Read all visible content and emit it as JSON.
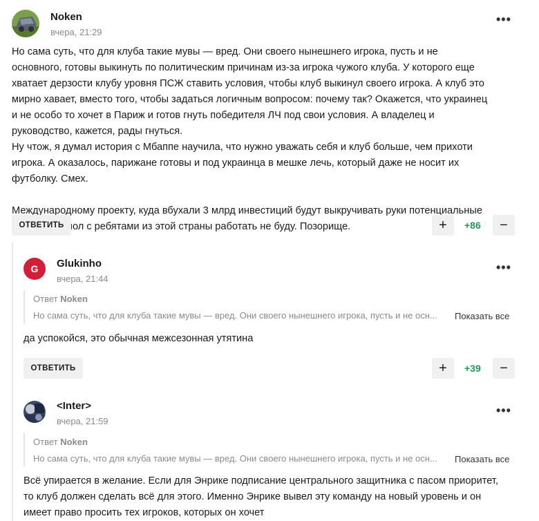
{
  "comments": [
    {
      "author": "Noken",
      "time": "вчера, 21:29",
      "paragraphs": [
        "Но сама суть, что для клуба такие мувы — вред. Они своего нынешнего игрока, пусть и не основного, готовы выкинуть по политическим причинам из-за игрока чужого клуба. У которого еще хватает дерзости клубу уровня ПСЖ ставить условия, чтобы клуб выкинул своего игрока. А клуб это мирно хавает, вместо того, чтобы задаться логичным вопросом: почему так? Окажется, что украинец и не особо то хочет в Париж и готов гнуть победителя ЛЧ под свои условия. А владелец и руководство, кажется, рады гнуться.",
        "Ну чтож, я думал история с Мбаппе научила, что нужно уважать себя и клуб больше, чем прихоти игрока. А оказалось, парижане готовы и под украинца в мешке лечь, который даже не носит их футболку. Смех.",
        "Международному проекту, куда вбухали 3 млрд инвестиций будут выкручивать руки потенциальные работники, мол с ребятами из этой страны работать не буду. Позорище."
      ],
      "reply_label": "ОТВЕТИТЬ",
      "score": "+86"
    },
    {
      "author": "Glukinho",
      "avatar_letter": "G",
      "time": "вчера, 21:44",
      "quote_prefix": "Ответ",
      "quote_author": "Noken",
      "quote_text": "Но сама суть, что для клуба такие мувы — вред. Они своего нынешнего игрока, пусть и не осн...",
      "show_all": "Показать все",
      "text": "да успокойся, это обычная межсезонная утятина",
      "reply_label": "ОТВЕТИТЬ",
      "score": "+39"
    },
    {
      "author": "<Inter>",
      "time": "вчера, 21:59",
      "quote_prefix": "Ответ",
      "quote_author": "Noken",
      "quote_text": "Но сама суть, что для клуба такие мувы — вред. Они своего нынешнего игрока, пусть и не осн...",
      "show_all": "Показать все",
      "text": "Всё упирается в желание. Если для Энрике подписание центрального защитника с пасом приоритет, то клуб должен сделать всё для этого. Именно Энрике вывел эту команду на новый уровень и он имеет право просить тех игроков, которых он хочет"
    }
  ],
  "icons": {
    "more": "more-dots-icon",
    "plus": "plus-icon",
    "minus": "minus-icon"
  },
  "colors": {
    "score": "#1f9b57",
    "avatar_g": "#d11f3a",
    "muted": "#8a8a8a"
  }
}
